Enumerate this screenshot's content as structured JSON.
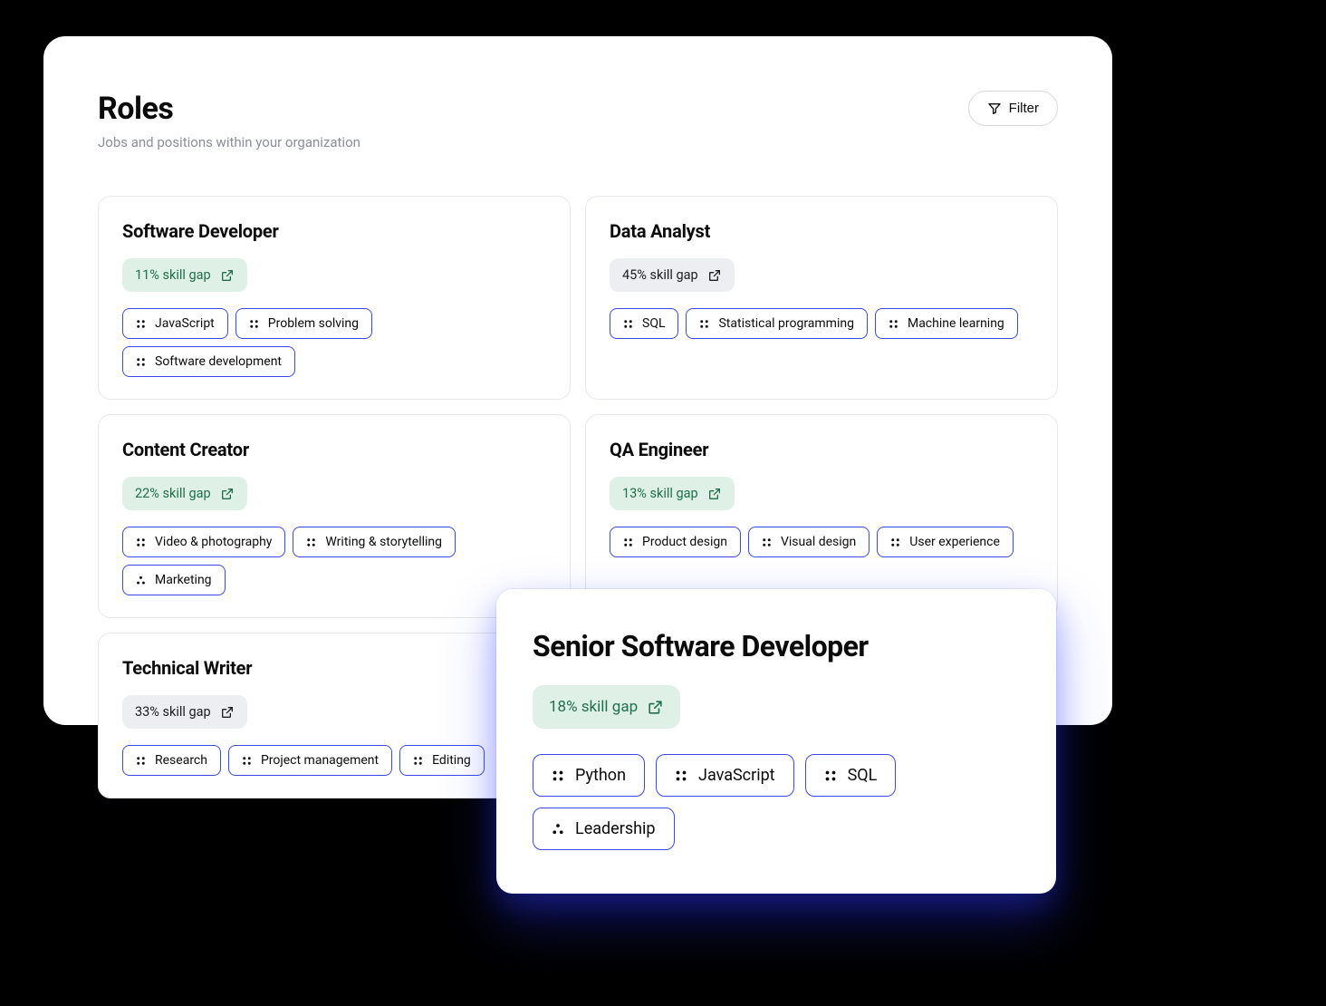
{
  "header": {
    "title": "Roles",
    "subtitle": "Jobs and positions within your organization",
    "filter_label": "Filter"
  },
  "roles": [
    {
      "title": "Software Developer",
      "gap_text": "11% skill gap",
      "gap_variant": "green",
      "skills": [
        {
          "label": "JavaScript",
          "icon": "grid4"
        },
        {
          "label": "Problem solving",
          "icon": "grid4"
        },
        {
          "label": "Software development",
          "icon": "grid4"
        }
      ]
    },
    {
      "title": "Data Analyst",
      "gap_text": "45% skill gap",
      "gap_variant": "gray",
      "skills": [
        {
          "label": "SQL",
          "icon": "grid4"
        },
        {
          "label": "Statistical programming",
          "icon": "grid4"
        },
        {
          "label": "Machine learning",
          "icon": "grid4"
        }
      ]
    },
    {
      "title": "Content Creator",
      "gap_text": "22% skill gap",
      "gap_variant": "green",
      "skills": [
        {
          "label": "Video & photography",
          "icon": "grid4"
        },
        {
          "label": "Writing & storytelling",
          "icon": "grid4"
        },
        {
          "label": "Marketing",
          "icon": "tri3"
        }
      ]
    },
    {
      "title": "QA Engineer",
      "gap_text": "13% skill gap",
      "gap_variant": "green",
      "skills": [
        {
          "label": "Product design",
          "icon": "grid4"
        },
        {
          "label": "Visual design",
          "icon": "grid4"
        },
        {
          "label": "User experience",
          "icon": "grid4"
        }
      ]
    },
    {
      "title": "Technical Writer",
      "gap_text": "33% skill gap",
      "gap_variant": "gray",
      "skills": [
        {
          "label": "Research",
          "icon": "grid4"
        },
        {
          "label": "Project management",
          "icon": "grid4"
        },
        {
          "label": "Editing",
          "icon": "grid4"
        }
      ]
    }
  ],
  "featured": {
    "title": "Senior Software Developer",
    "gap_text": "18% skill gap",
    "gap_variant": "green",
    "skills": [
      {
        "label": "Python",
        "icon": "grid4"
      },
      {
        "label": "JavaScript",
        "icon": "grid4"
      },
      {
        "label": "SQL",
        "icon": "grid4"
      },
      {
        "label": "Leadership",
        "icon": "tri3"
      }
    ]
  }
}
